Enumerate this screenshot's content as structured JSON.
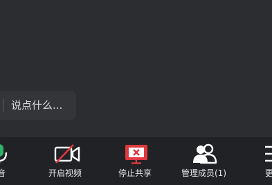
{
  "chat": {
    "placeholder": "说点什么..."
  },
  "toolbar": {
    "items": [
      {
        "label": "音",
        "icon": "microphone-icon",
        "color": "#2fb36b"
      },
      {
        "label": "开启视频",
        "icon": "video-off-icon",
        "color": "#ffffff",
        "slash_color": "#e0383e"
      },
      {
        "label": "停止共享",
        "icon": "stop-share-icon",
        "color": "#e0383e"
      },
      {
        "label": "管理成员(1)",
        "icon": "members-icon",
        "color": "#ffffff"
      },
      {
        "label": "更",
        "icon": "more-icon",
        "color": "#ffffff"
      }
    ]
  }
}
